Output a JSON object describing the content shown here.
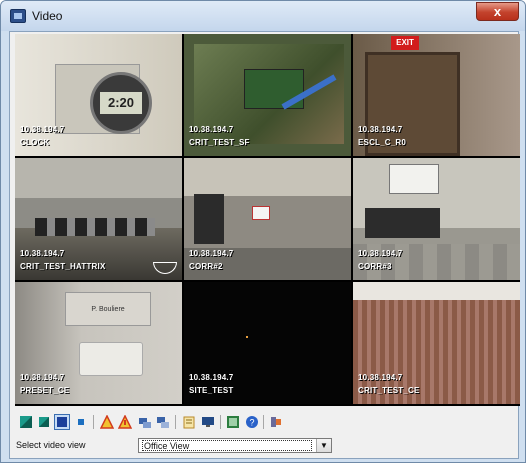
{
  "window": {
    "title": "Video",
    "close_label": "x"
  },
  "cameras": [
    {
      "ip": "10.38.194.7",
      "name": "CLOCK"
    },
    {
      "ip": "10.38.194.7",
      "name": "CRIT_TEST_SF"
    },
    {
      "ip": "10.38.194.7",
      "name": "ESCL_C_R0"
    },
    {
      "ip": "10.38.194.7",
      "name": "CRIT_TEST_HATTRIX"
    },
    {
      "ip": "10.38.194.7",
      "name": "CORR#2"
    },
    {
      "ip": "10.38.194.7",
      "name": "CORR#3"
    },
    {
      "ip": "10.38.194.7",
      "name": "PRESET_CE"
    },
    {
      "ip": "10.38.194.7",
      "name": "SITE_TEST"
    },
    {
      "ip": "10.38.194.7",
      "name": "CRIT_TEST_CE"
    }
  ],
  "scene_text": {
    "clock_reading": "2:20",
    "exit_sign": "EXIT",
    "door_plate": "P. Bouliere"
  },
  "toolbar": {
    "buttons": [
      {
        "icon": "layout-1x1-icon",
        "color": "#1a9a8a"
      },
      {
        "icon": "layout-2x2-icon",
        "color": "#1a9a8a"
      },
      {
        "icon": "layout-3x3-icon",
        "color": "#1c3f9a"
      },
      {
        "icon": "layout-4x4-icon",
        "color": "#1c6fc0"
      },
      {
        "icon": "ptz-warning-icon",
        "color": "#d23b1d"
      },
      {
        "icon": "ptz-warning-alt-icon",
        "color": "#d23b1d"
      },
      {
        "icon": "camera-group-icon",
        "color": "#3a63a8"
      },
      {
        "icon": "camera-group-alt-icon",
        "color": "#3a63a8"
      },
      {
        "icon": "notes-icon",
        "color": "#d8a02b"
      },
      {
        "icon": "monitor-icon",
        "color": "#234a86"
      },
      {
        "icon": "snapshot-icon",
        "color": "#2c7d3f"
      },
      {
        "icon": "help-icon",
        "color": "#2a62c9"
      },
      {
        "icon": "settings-icon",
        "color": "#6a6a9a"
      }
    ]
  },
  "view_select": {
    "label": "Select video view",
    "value": "Office View",
    "arrow": "▼"
  }
}
